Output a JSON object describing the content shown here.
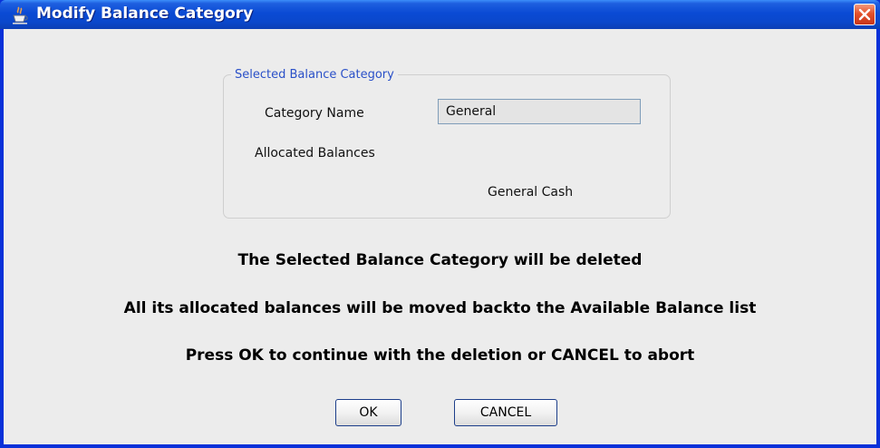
{
  "window": {
    "title": "Modify Balance Category",
    "icon": "java-coffee-cup-icon",
    "close_icon": "close-icon"
  },
  "group": {
    "legend": "Selected Balance Category",
    "category_name_label": "Category Name",
    "category_name_value": "General",
    "allocated_balances_label": "Allocated Balances",
    "allocated_balances": [
      "General Cash"
    ]
  },
  "messages": {
    "line1": "The Selected Balance Category will be deleted",
    "line2": "All its allocated balances will be moved backto the Available Balance list",
    "line3": "Press OK to continue with the deletion or CANCEL to abort"
  },
  "buttons": {
    "ok": "OK",
    "cancel": "CANCEL"
  },
  "colors": {
    "title_bar": "#0a48cc",
    "close_button": "#e3512a",
    "group_legend": "#2a50c8",
    "dialog_background": "#ececec"
  }
}
